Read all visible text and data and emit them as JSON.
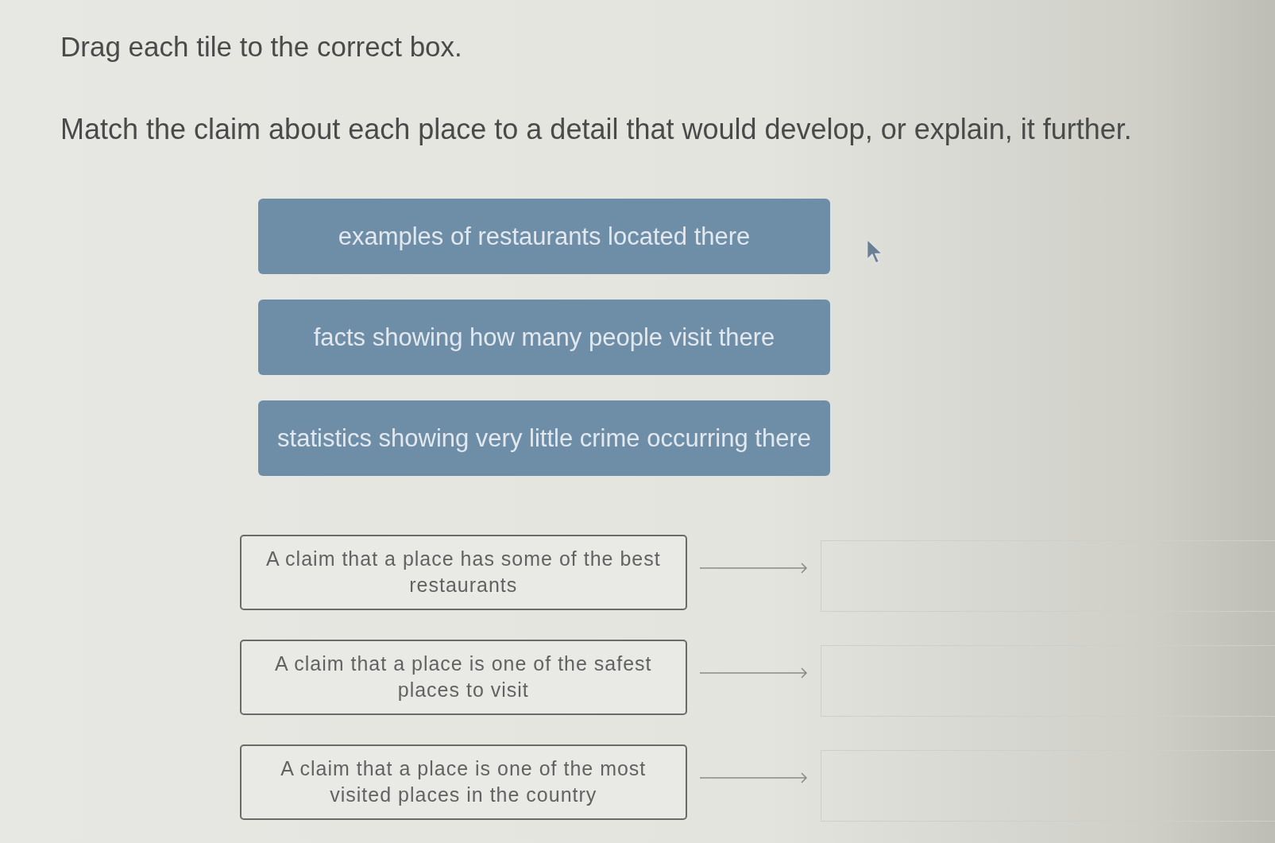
{
  "instructions": "Drag each tile to the correct box.",
  "question": "Match the claim about each place to a detail that would develop, or explain, it further.",
  "tiles": [
    "examples of restaurants located there",
    "facts showing how many people visit there",
    "statistics showing very little crime occurring there"
  ],
  "claims": [
    "A claim that a place has some of the best restaurants",
    "A claim that a place is one of the safest places to visit",
    "A claim that a place is one of the most visited places in the country"
  ]
}
